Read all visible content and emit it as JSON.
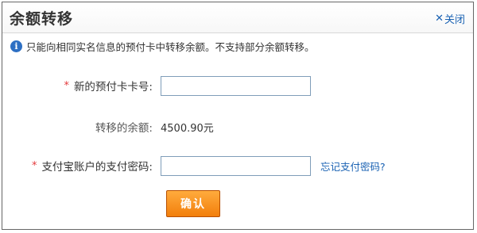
{
  "dialog": {
    "title": "余额转移",
    "close_icon": "close-x-icon",
    "close_label": "关闭",
    "notice_icon": "info-icon",
    "notice_icon_glyph": "i",
    "notice_text": "只能向相同实名信息的预付卡中转移余额。不支持部分余额转移。"
  },
  "form": {
    "card_number": {
      "required_mark": "*",
      "label": "新的预付卡卡号:",
      "value": ""
    },
    "transfer_amount": {
      "label": "转移的余额:",
      "value": "4500.90元"
    },
    "alipay_password": {
      "required_mark": "*",
      "label": "支付宝账户的支付密码:",
      "value": "",
      "forgot_link": "忘记支付密码?"
    },
    "confirm_label": "确认"
  },
  "colors": {
    "accent_orange": "#f27f0c",
    "link_blue": "#1a62b3",
    "required_red": "#e4393c"
  }
}
